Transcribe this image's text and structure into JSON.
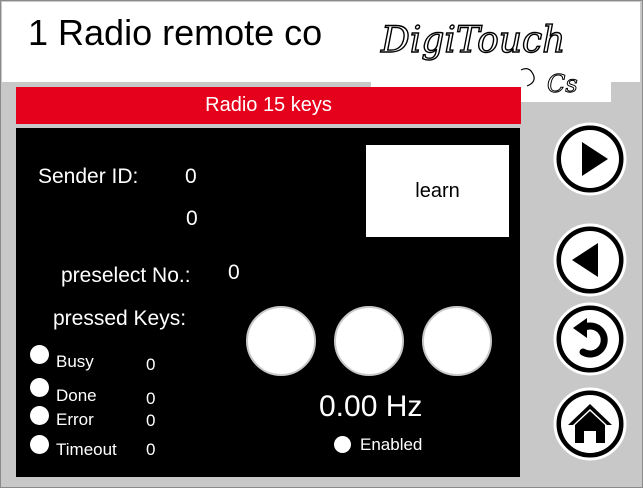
{
  "header": {
    "title": "1 Radio remote co",
    "logo_text": "DigiTouch"
  },
  "mode_bar": {
    "label": "Radio 15 keys"
  },
  "sender": {
    "label": "Sender ID:",
    "value1": "0",
    "value2": "0"
  },
  "learn_button": {
    "label": "learn"
  },
  "preselect": {
    "label": "preselect No.:",
    "value": "0"
  },
  "pressed_keys": {
    "label": "pressed Keys:"
  },
  "frequency": {
    "value": "0.00 Hz"
  },
  "enabled": {
    "label": "Enabled"
  },
  "status": [
    {
      "label": "Busy",
      "value": "0"
    },
    {
      "label": "Done",
      "value": "0"
    },
    {
      "label": "Error",
      "value": "0"
    },
    {
      "label": "Timeout",
      "value": "0"
    }
  ],
  "nav_buttons": [
    {
      "icon": "play-forward-icon"
    },
    {
      "icon": "play-back-icon"
    },
    {
      "icon": "undo-icon"
    },
    {
      "icon": "home-icon"
    }
  ],
  "colors": {
    "accent_red": "#e5001c",
    "panel_black": "#000000",
    "background_gray": "#c8c8c8"
  }
}
